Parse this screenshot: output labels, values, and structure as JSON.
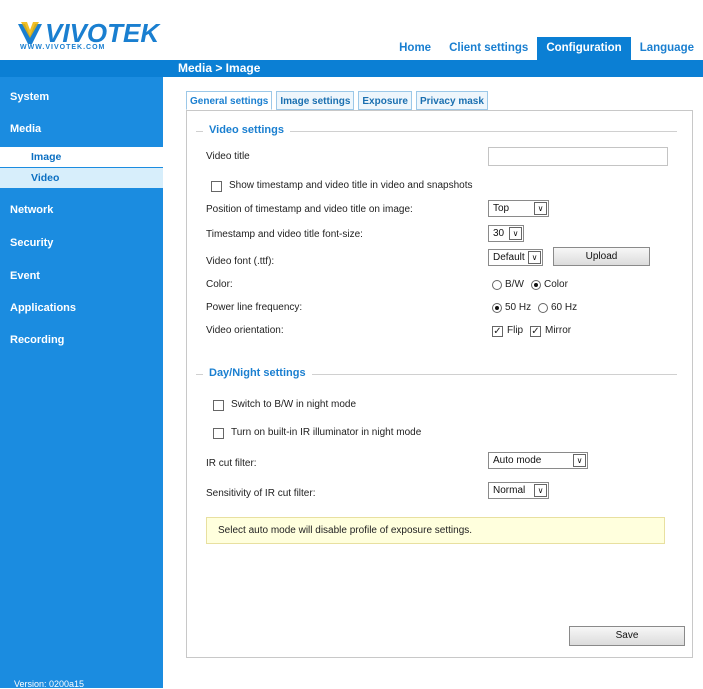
{
  "header": {
    "logo_text": "VIVOTEK",
    "logo_sub": "WWW.VIVOTEK.COM",
    "nav": [
      "Home",
      "Client settings",
      "Configuration",
      "Language"
    ],
    "active_nav": "Configuration"
  },
  "title": "Media > Image",
  "sidebar": {
    "items": [
      "System",
      "Media",
      "Network",
      "Security",
      "Event",
      "Applications",
      "Recording"
    ],
    "sub_items": [
      "Image",
      "Video"
    ],
    "version": "Version: 0200a15"
  },
  "tabs": [
    "General settings",
    "Image settings",
    "Exposure",
    "Privacy mask"
  ],
  "video_settings": {
    "legend": "Video settings",
    "video_title_label": "Video title",
    "video_title_value": "",
    "show_timestamp_label": "Show timestamp and video title in video and snapshots",
    "position_label": "Position of timestamp and video title on image:",
    "position_value": "Top",
    "fontsize_label": "Timestamp and video title font-size:",
    "fontsize_value": "30",
    "font_label": "Video font (.ttf):",
    "font_value": "Default",
    "upload_label": "Upload",
    "color_label": "Color:",
    "color_bw": "B/W",
    "color_color": "Color",
    "power_label": "Power line frequency:",
    "power_50": "50 Hz",
    "power_60": "60 Hz",
    "orientation_label": "Video orientation:",
    "flip_label": "Flip",
    "mirror_label": "Mirror"
  },
  "day_night": {
    "legend": "Day/Night settings",
    "switch_bw_label": "Switch to B/W in night mode",
    "ir_illuminator_label": "Turn on built-in IR illuminator in night mode",
    "ir_cut_label": "IR cut filter:",
    "ir_cut_value": "Auto mode",
    "sensitivity_label": "Sensitivity of IR cut filter:",
    "sensitivity_value": "Normal",
    "notice": "Select auto mode will disable profile of exposure settings."
  },
  "save_label": "Save",
  "colors": {
    "accent": "#0b7fd4",
    "sidebar": "#1b8ce0",
    "link": "#1a7fd0",
    "notice_bg": "#ffffdd"
  }
}
